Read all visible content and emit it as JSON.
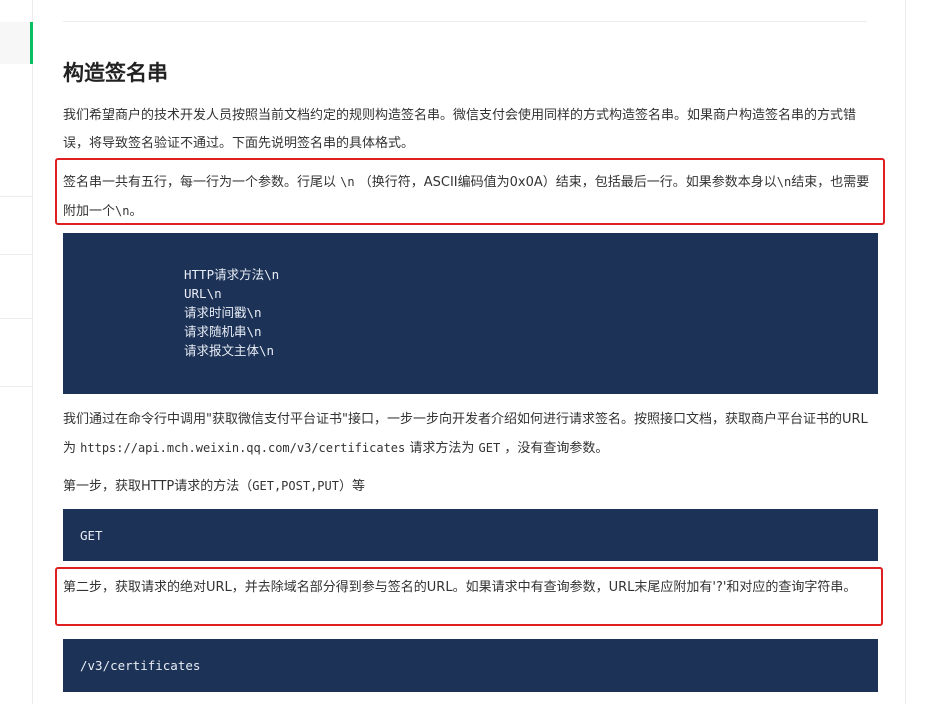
{
  "section_title": "构造签名串",
  "intro": "我们希望商户的技术开发人员按照当前文档约定的规则构造签名串。微信支付会使用同样的方式构造签名串。如果商户构造签名串的方式错误，将导致签名验证不通过。下面先说明签名串的具体格式。",
  "format_note": {
    "t1": "签名串一共有五行，每一行为一个参数。行尾以 ",
    "c1": "\\n",
    "t2": " （换行符，ASCII编码值为0x0A）结束，包括最后一行。如果参数本身以",
    "c2": "\\n",
    "t3": "结束，也需要附加一个",
    "c3": "\\n",
    "t4": "。"
  },
  "format_code": [
    "HTTP请求方法\\n",
    "URL\\n",
    "请求时间戳\\n",
    "请求随机串\\n",
    "请求报文主体\\n"
  ],
  "example_intro": {
    "t1": "我们通过在命令行中调用\"获取微信支付平台证书\"接口，一步一步向开发者介绍如何进行请求签名。按照接口文档，获取商户平台证书的URL为 ",
    "url": "https://api.mch.weixin.qq.com/v3/certificates",
    "t2": " 请求方法为 ",
    "method": "GET",
    "t3": " ，没有查询参数。"
  },
  "step1": {
    "t1": "第一步，获取HTTP请求的方法（",
    "methods": "GET,POST,PUT",
    "t2": "）等"
  },
  "step1_code": "GET",
  "step2": "第二步，获取请求的绝对URL，并去除域名部分得到参与签名的URL。如果请求中有查询参数，URL末尾应附加有'?'和对应的查询字符串。",
  "step2_code": "/v3/certificates",
  "colors": {
    "accent": "#07c160",
    "code_bg": "#1d3257",
    "highlight": "#e02020"
  }
}
